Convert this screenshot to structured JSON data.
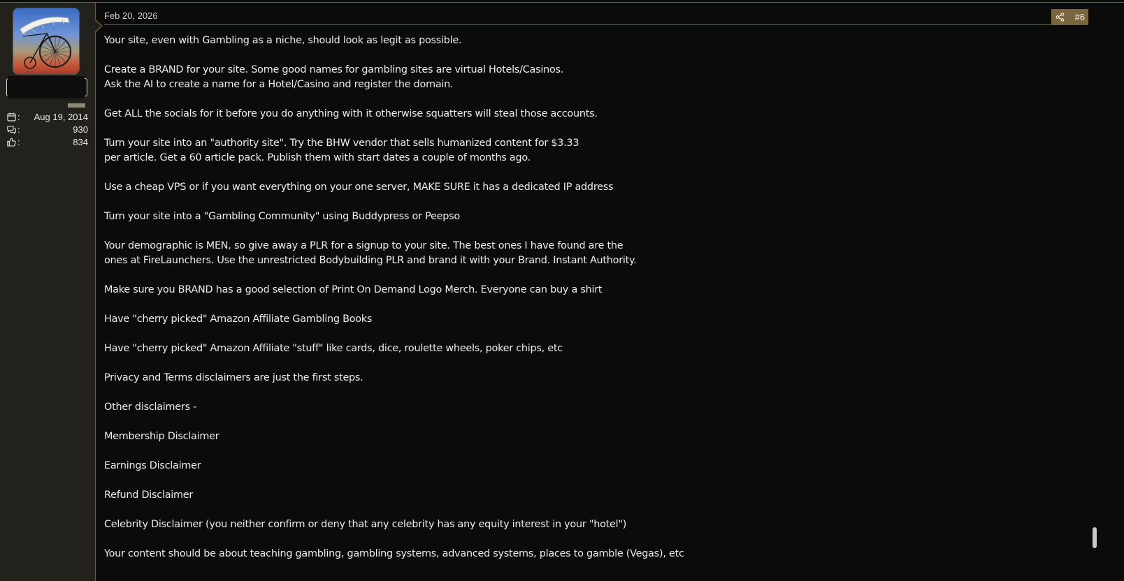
{
  "post": {
    "date": "Feb 20, 2026",
    "number": "#6",
    "paragraphs": [
      [
        "Your site, even with Gambling as a niche, should look as legit as possible."
      ],
      [
        "Create a BRAND for your site. Some good names for gambling sites are virtual Hotels/Casinos.",
        "Ask the AI to create a name for a Hotel/Casino and register the domain."
      ],
      [
        "Get ALL the socials for it before you do anything with it otherwise squatters will steal those accounts."
      ],
      [
        "Turn your site into an \"authority site\". Try the BHW vendor that sells humanized content for $3.33",
        "per article. Get a 60 article pack. Publish them with start dates a couple of months ago."
      ],
      [
        "Use a cheap VPS or if you want everything on your one server, MAKE SURE it has a dedicated IP address"
      ],
      [
        "Turn your site into a \"Gambling Community\" using Buddypress or Peepso"
      ],
      [
        "Your demographic is MEN, so give away a PLR for a signup to your site. The best ones I have found are the",
        "ones at FireLaunchers. Use the unrestricted Bodybuilding PLR and brand it with your Brand. Instant Authority."
      ],
      [
        "Make sure you BRAND has a good selection of Print On Demand Logo Merch. Everyone can buy a shirt"
      ],
      [
        "Have \"cherry picked\" Amazon Affiliate Gambling Books"
      ],
      [
        "Have \"cherry picked\" Amazon Affiliate \"stuff\" like cards, dice, roulette wheels, poker chips, etc"
      ],
      [
        "Privacy and Terms disclaimers are just the first steps."
      ],
      [
        "Other disclaimers -"
      ],
      [
        "Membership Disclaimer"
      ],
      [
        "Earnings Disclaimer"
      ],
      [
        "Refund Disclaimer"
      ],
      [
        "Celebrity Disclaimer (you neither confirm or deny that any celebrity has any equity interest in your \"hotel\")"
      ],
      [
        "Your content should be about teaching gambling, gambling systems, advanced systems, places to gamble (Vegas), etc"
      ]
    ]
  },
  "user": {
    "joined": "Aug 19, 2014",
    "messages": "930",
    "reactions": "834",
    "stat_colon": ":"
  },
  "icons": {
    "joined": "calendar-icon",
    "messages": "chat-bubbles-icon",
    "reactions": "thumbs-up-icon",
    "share": "share-icon"
  },
  "colors": {
    "background": "#0b0b0b",
    "sidebar": "#23211c",
    "accent": "#7a663c",
    "rule": "#6f6034"
  }
}
